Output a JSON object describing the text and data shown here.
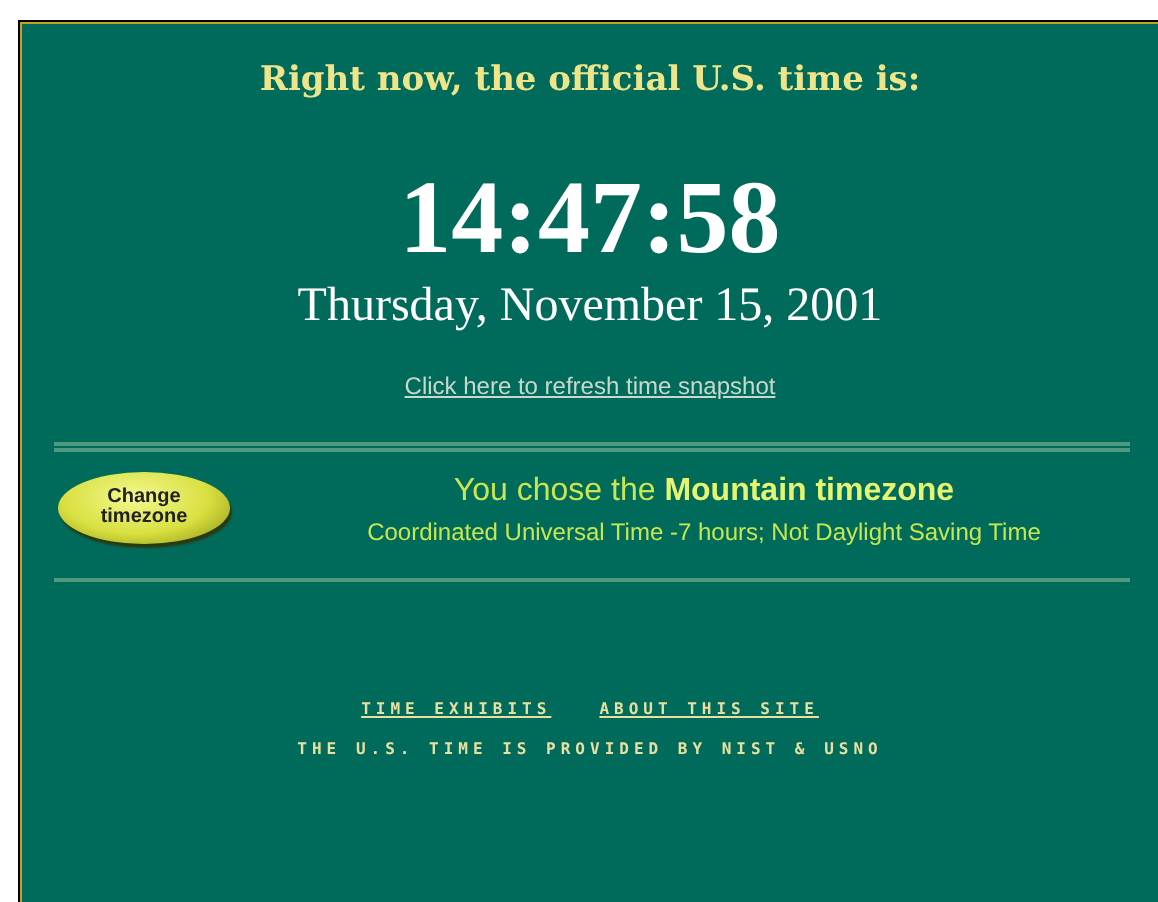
{
  "heading": "Right now, the official U.S. time is:",
  "time": "14:47:58",
  "date": "Thursday, November 15, 2001",
  "refresh_link": "Click here to refresh time snapshot",
  "timezone": {
    "button": "Change timezone",
    "chosen": "You chose the **Mountain timezone**",
    "detail": "Coordinated Universal Time -7 hours; Not Daylight Saving Time"
  },
  "footer": {
    "links": [
      "TIME EXHIBITS",
      "ABOUT THIS SITE"
    ],
    "credit": "THE U.S. TIME IS PROVIDED BY NIST & USNO"
  }
}
